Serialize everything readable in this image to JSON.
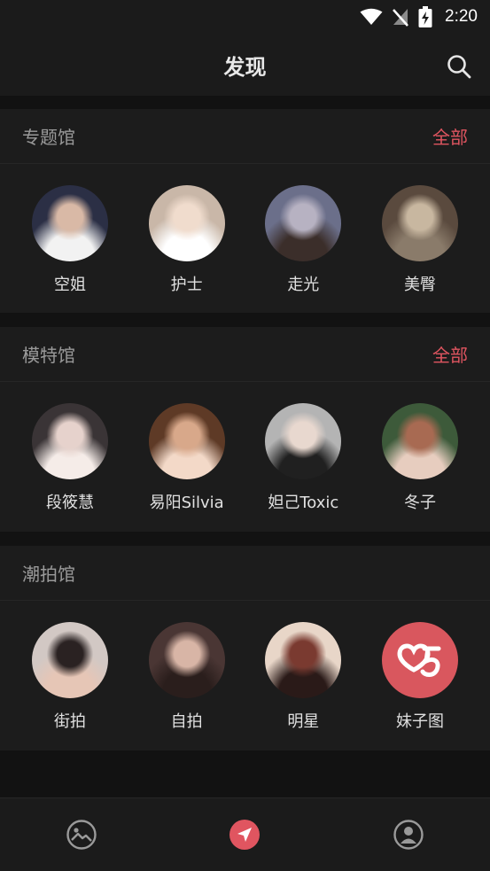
{
  "status": {
    "time": "2:20"
  },
  "header": {
    "title": "发现"
  },
  "sections": [
    {
      "title": "专题馆",
      "all_label": "全部",
      "items": [
        {
          "label": "空姐",
          "avatar_colors": [
            "#2b2f45",
            "#d9b9a6",
            "#f2f2f2"
          ]
        },
        {
          "label": "护士",
          "avatar_colors": [
            "#c9b7a8",
            "#f0dccd",
            "#ffffff"
          ]
        },
        {
          "label": "走光",
          "avatar_colors": [
            "#6b6f8a",
            "#b7b2c2",
            "#3b2e2a"
          ]
        },
        {
          "label": "美臀",
          "avatar_colors": [
            "#5a4a3e",
            "#c8b7a0",
            "#8a7b6a"
          ]
        }
      ]
    },
    {
      "title": "模特馆",
      "all_label": "全部",
      "items": [
        {
          "label": "段筱慧",
          "avatar_colors": [
            "#3a3436",
            "#e6d2cc",
            "#f5ece8"
          ]
        },
        {
          "label": "易阳Silvia",
          "avatar_colors": [
            "#5e3a26",
            "#d8a88a",
            "#f3d9c8"
          ]
        },
        {
          "label": "妲己Toxic",
          "avatar_colors": [
            "#b4b4b4",
            "#e8d8cf",
            "#202020"
          ]
        },
        {
          "label": "冬子",
          "avatar_colors": [
            "#3d5a3a",
            "#a86a52",
            "#e7cdbf"
          ]
        }
      ]
    },
    {
      "title": "潮拍馆",
      "all_label": "",
      "items": [
        {
          "label": "街拍",
          "avatar_colors": [
            "#d2c8c4",
            "#2a2222",
            "#e6c6b6"
          ]
        },
        {
          "label": "自拍",
          "avatar_colors": [
            "#4a3634",
            "#d8b5a6",
            "#2a1e1c"
          ]
        },
        {
          "label": "明星",
          "avatar_colors": [
            "#e8d6c8",
            "#7a3a30",
            "#2a1a18"
          ]
        },
        {
          "label": "妹子图",
          "avatar_colors": [
            "#d9575e",
            "#ffffff",
            "#d9575e"
          ],
          "logo": true
        }
      ]
    }
  ],
  "bottom_nav": [
    {
      "icon": "gallery-face-icon",
      "active": false
    },
    {
      "icon": "compass-arrow-icon",
      "active": true
    },
    {
      "icon": "profile-icon",
      "active": false
    }
  ],
  "colors": {
    "accent": "#e05560",
    "background": "#121212",
    "surface": "#1c1c1c"
  }
}
